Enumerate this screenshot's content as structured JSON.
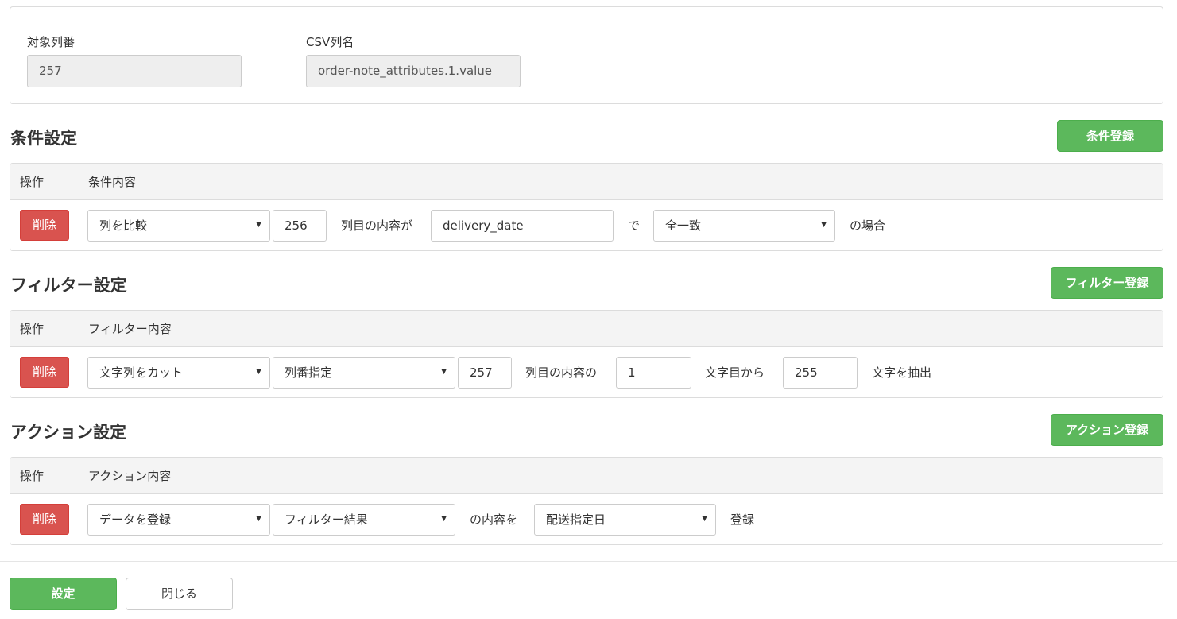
{
  "target": {
    "column_number_label": "対象列番",
    "column_number_value": "257",
    "csv_column_label": "CSV列名",
    "csv_column_value": "order-note_attributes.1.value"
  },
  "conditions": {
    "title": "条件設定",
    "register_button": "条件登録",
    "header_operation": "操作",
    "header_content": "条件内容",
    "row": {
      "delete_button": "削除",
      "type_select": "列を比較",
      "column_input": "256",
      "text_after_column": "列目の内容が",
      "value_input": "delivery_date",
      "text_de": "で",
      "match_select": "全一致",
      "text_suffix": "の場合"
    }
  },
  "filters": {
    "title": "フィルター設定",
    "register_button": "フィルター登録",
    "header_operation": "操作",
    "header_content": "フィルター内容",
    "row": {
      "delete_button": "削除",
      "type_select": "文字列をカット",
      "mode_select": "列番指定",
      "column_input": "257",
      "text_after_column": "列目の内容の",
      "start_input": "1",
      "text_from": "文字目から",
      "length_input": "255",
      "text_extract": "文字を抽出"
    }
  },
  "actions": {
    "title": "アクション設定",
    "register_button": "アクション登録",
    "header_operation": "操作",
    "header_content": "アクション内容",
    "row": {
      "delete_button": "削除",
      "type_select": "データを登録",
      "source_select": "フィルター結果",
      "text_content": "の内容を",
      "target_select": "配送指定日",
      "text_register": "登録"
    }
  },
  "footer": {
    "submit_button": "設定",
    "close_button": "閉じる"
  },
  "icons": {
    "select_caret": "caret-down-icon"
  },
  "colors": {
    "success": "#5cb85c",
    "danger": "#d9534f",
    "readonly_bg": "#eeeeee",
    "header_bg": "#f4f4f4"
  }
}
